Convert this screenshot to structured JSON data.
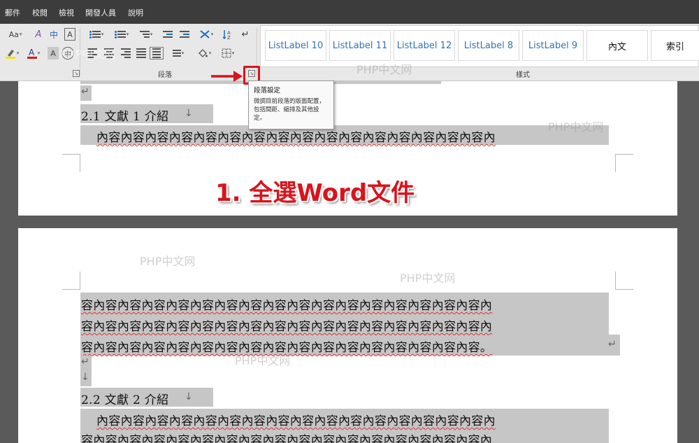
{
  "menu": [
    "郵件",
    "校閱",
    "檢視",
    "開發人員",
    "說明"
  ],
  "ribbon": {
    "font_group": {
      "aa_label": "Aa",
      "char_spacing_label": "中"
    },
    "paragraph_group_label": "段落",
    "styles_group_label": "樣式",
    "styles": [
      "ListLabel 10",
      "ListLabel 11",
      "ListLabel 12",
      "ListLabel 8",
      "ListLabel 9",
      "內文",
      "索引"
    ],
    "colors": {
      "link_style": "#2e74b5",
      "normal_style": "#111111"
    }
  },
  "tooltip": {
    "title": "段落設定",
    "body": "微調目前段落的版面配置，包括間距、縮排及其他設定。"
  },
  "annotation": "1. 全選Word文件",
  "watermarks": [
    "PHP中文网",
    "PHP中文网",
    "PHP中文网",
    "PHP中文网",
    "PHP中文网",
    "PHP中文网"
  ],
  "document": {
    "page1": {
      "heading": "2.1 文獻 1 介紹",
      "body": "內容內容內容內容內容內容內容內容內容內容內容內容內容內容內容內容內"
    },
    "page2": {
      "lines": [
        "容內容內容內容內容內容內容內容內容內容內容內容內容內容內容內容內容內",
        "容內容內容內容內容內容內容內容內容內容內容內容內容內容內容內容內容內",
        "容內容內容內容內容內容內容內容內容內容內容內容內容內容內容內容內容。"
      ],
      "heading": "2.2 文獻 2 介紹",
      "body": [
        "內容內容內容內容內容內容內容內容內容內容內容內容內容內容內容內容內",
        "容內容內容內容內容內容內容內容內容內容內容內容內容內容內容內容內容內"
      ]
    },
    "marks": {
      "paragraph": "↵",
      "line_break": "↓"
    }
  }
}
